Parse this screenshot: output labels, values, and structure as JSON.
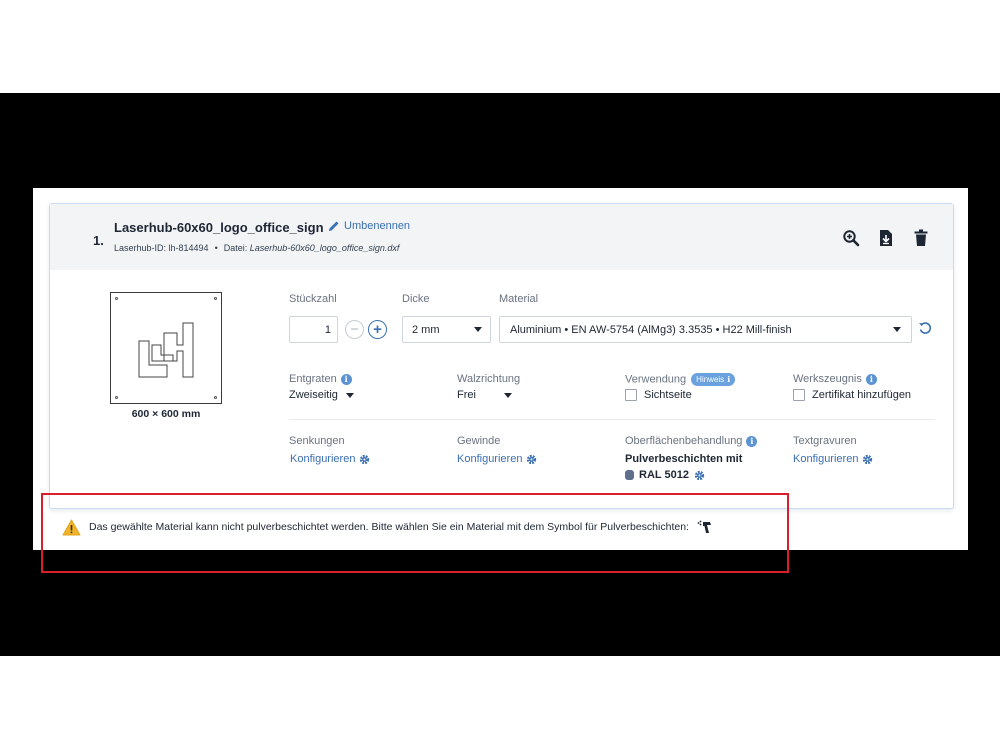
{
  "part": {
    "index": "1.",
    "title": "Laserhub-60x60_logo_office_sign",
    "rename_label": "Umbenennen",
    "laserhub_id": "Laserhub-ID: lh-814494",
    "separator": "•",
    "file_label": "Datei:",
    "file_name": "Laserhub-60x60_logo_office_sign.dxf",
    "dimensions": "600 × 600 mm"
  },
  "header_actions": [
    "zoom-in-icon",
    "download-icon",
    "trash-icon"
  ],
  "fields": {
    "quantity": {
      "label": "Stückzahl",
      "value": "1",
      "minus": "−",
      "plus": "+"
    },
    "thickness": {
      "label": "Dicke",
      "value": "2 mm"
    },
    "material": {
      "label": "Material",
      "value": "Aluminium • EN AW-5754 (AlMg3) 3.3535 • H22 Mill-finish"
    },
    "deburring": {
      "label": "Entgraten",
      "value": "Zweiseitig"
    },
    "rolling_direction": {
      "label": "Walzrichtung",
      "value": "Frei"
    },
    "usage": {
      "label": "Verwendung",
      "hint": "Hinweis",
      "checkbox_label": "Sichtseite"
    },
    "certificate": {
      "label": "Werkszeugnis",
      "checkbox_label": "Zertifikat hinzufügen"
    },
    "countersinks": {
      "label": "Senkungen",
      "link": "Konfigurieren"
    },
    "threads": {
      "label": "Gewinde",
      "link": "Konfigurieren"
    },
    "surface": {
      "label": "Oberflächenbehandlung",
      "value_line1": "Pulverbeschichten mit",
      "value_line2": "RAL 5012"
    },
    "engraving": {
      "label": "Textgravuren",
      "link": "Konfigurieren"
    }
  },
  "warning": {
    "text": "Das gewählte Material kann nicht pulverbeschichtet werden. Bitte wählen Sie ein Material mit dem Symbol für Pulverbeschichten:"
  },
  "colors": {
    "accent": "#3a6fb2",
    "info": "#5b93d3",
    "warning": "#f0b429",
    "highlight": "#d9202a",
    "swatch_ral_5012": "#5d6f8a"
  }
}
